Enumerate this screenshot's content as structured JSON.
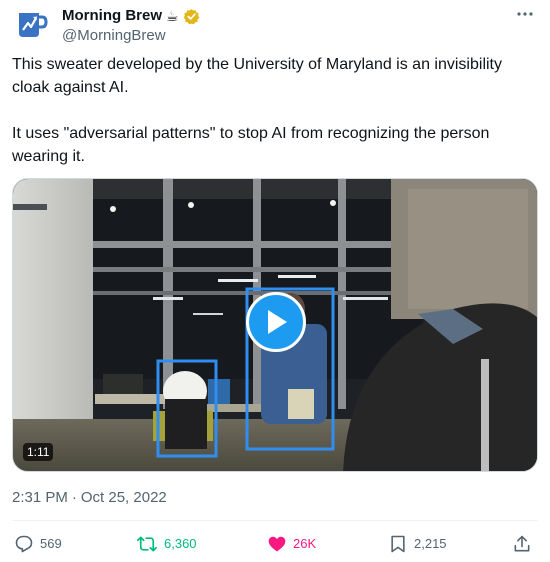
{
  "author": {
    "display_name": "Morning Brew",
    "name_emoji": "☕",
    "handle": "@MorningBrew",
    "verified_badge": "gold-verified-badge",
    "avatar_icon": "morning-brew-mug-logo"
  },
  "tweet": {
    "paragraphs": [
      "This sweater developed by the University of Maryland is an invisibility cloak against AI.",
      "It uses \"adversarial patterns\" to stop AI from recognizing the person wearing it."
    ]
  },
  "media": {
    "type": "video",
    "duration": "1:11",
    "play_icon": "play-icon"
  },
  "timestamp": {
    "time": "2:31 PM",
    "separator": "·",
    "date": "Oct 25, 2022"
  },
  "actions": {
    "replies": "569",
    "retweets": "6,360",
    "likes": "26K",
    "bookmarks": "2,215",
    "reply_icon": "reply-icon",
    "retweet_icon": "retweet-icon",
    "like_icon": "heart-filled-icon",
    "bookmark_icon": "bookmark-icon",
    "share_icon": "share-icon"
  },
  "colors": {
    "accent_blue": "#1d9bf0",
    "retweet_green": "#00ba7c",
    "like_pink": "#f91880",
    "muted_gray": "#536471",
    "verified_gold": "#e2b719"
  }
}
